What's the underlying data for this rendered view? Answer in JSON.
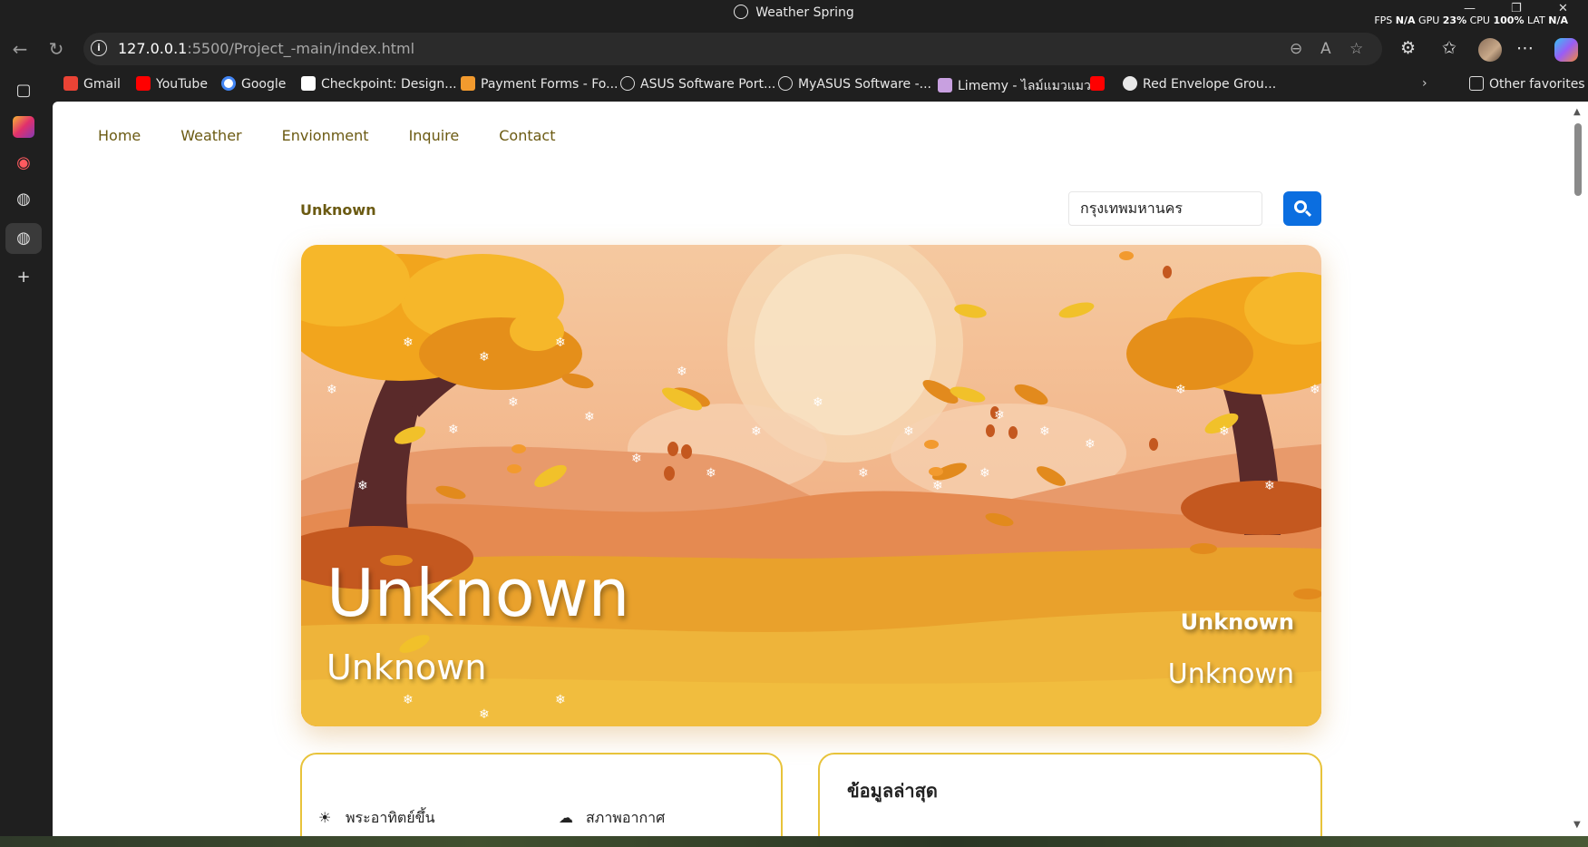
{
  "window": {
    "title": "Weather Spring",
    "stats": {
      "fps_label": "FPS",
      "fps": "N/A",
      "gpu_label": "GPU",
      "gpu": "23%",
      "cpu_label": "CPU",
      "cpu": "100%",
      "lat_label": "LAT",
      "lat": "N/A"
    }
  },
  "address_bar": {
    "host": "127.0.0.1",
    "path": ":5500/Project_-main/index.html"
  },
  "bookmarks": [
    {
      "label": "Gmail",
      "icon": "gmail-icon",
      "color": "#ea4335"
    },
    {
      "label": "YouTube",
      "icon": "youtube-icon",
      "color": "#ff0000"
    },
    {
      "label": "Google",
      "icon": "google-icon",
      "color": "#4285f4"
    },
    {
      "label": "Checkpoint: Design...",
      "icon": "page-icon",
      "color": "#ffffff"
    },
    {
      "label": "Payment Forms - Fo...",
      "icon": "forms-icon",
      "color": "#f29a2e"
    },
    {
      "label": "ASUS Software Port...",
      "icon": "globe-icon",
      "color": "#dddddd"
    },
    {
      "label": "MyASUS Software -...",
      "icon": "globe-icon",
      "color": "#dddddd"
    },
    {
      "label": "Limemy - ไลม์แมวแมว",
      "icon": "limemy-icon",
      "color": "#c8a0e0"
    },
    {
      "label": "",
      "icon": "youtube-icon",
      "color": "#ff0000"
    },
    {
      "label": "Red Envelope Grou...",
      "icon": "envelope-icon",
      "color": "#e8e8e8"
    }
  ],
  "other_favorites": "Other favorites",
  "site": {
    "nav": [
      "Home",
      "Weather",
      "Envionment",
      "Inquire",
      "Contact"
    ],
    "city": "Unknown",
    "search_value": "กรุงเทพมหานคร",
    "hero": {
      "main_temp": "Unknown",
      "sub": "Unknown",
      "right_top": "Unknown",
      "right_bottom": "Unknown"
    },
    "card1": {
      "row1": "พระอาทิตย์ขึ้น",
      "row2": "สภาพอากาศ"
    },
    "card2": {
      "title": "ข้อมูลล่าสุด"
    }
  },
  "colors": {
    "nav_text": "#6b5a12",
    "search_button": "#0b6ee0",
    "card_border": "#e8c33a"
  }
}
